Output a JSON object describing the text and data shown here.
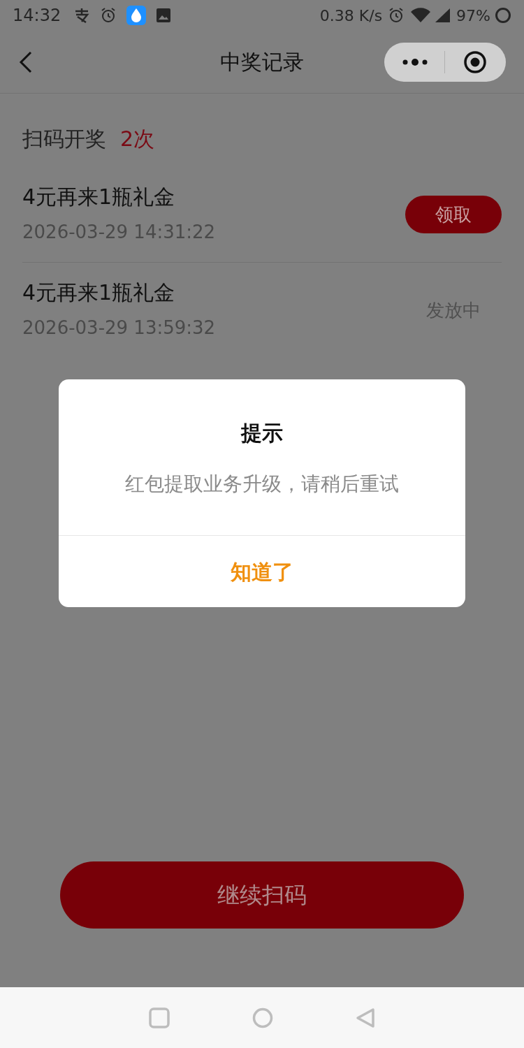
{
  "status_bar": {
    "time": "14:32",
    "net_speed": "0.38 K/s",
    "battery": "97%"
  },
  "header": {
    "title": "中奖记录"
  },
  "summary": {
    "label": "扫码开奖",
    "count": "2次"
  },
  "records": [
    {
      "name": "4元再来1瓶礼金",
      "time": "2026-03-29 14:31:22",
      "action": {
        "kind": "button",
        "text": "领取"
      }
    },
    {
      "name": "4元再来1瓶礼金",
      "time": "2026-03-29 13:59:32",
      "action": {
        "kind": "status",
        "text": "发放中"
      }
    }
  ],
  "dialog": {
    "title": "提示",
    "message": "红包提取业务升级，请稍后重试",
    "button": "知道了"
  },
  "bottom_button": "继续扫码"
}
